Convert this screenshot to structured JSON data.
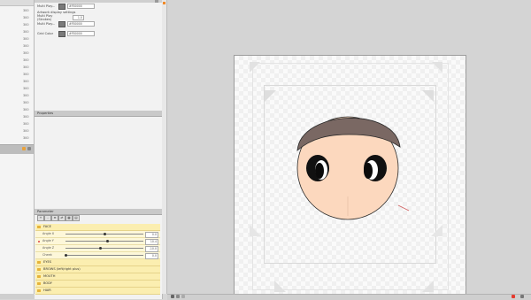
{
  "left_list": {
    "numbers": [
      "300",
      "300",
      "300",
      "300",
      "300",
      "300",
      "300",
      "300",
      "300",
      "300",
      "300",
      "300",
      "300",
      "300",
      "300",
      "300",
      "300",
      "300",
      "300"
    ]
  },
  "inspector": {
    "rows": [
      {
        "label": "Multi Play...",
        "value": "#FB0000"
      },
      {
        "label": "Artwork display settings",
        "value": ""
      },
      {
        "label": "Multi Play (Strokes)",
        "value": "1.0"
      },
      {
        "label": "Multi Play...",
        "value": "#FB0000"
      },
      {
        "label": "Grid Color",
        "value": "#FB0000"
      }
    ]
  },
  "mid_panel": {
    "title": "Properties"
  },
  "param_panel": {
    "title": "Parameter",
    "toolbar_buttons": [
      "+",
      "-",
      "≡",
      "⇄",
      "▦",
      "▤"
    ],
    "groups": [
      {
        "label": "FACE",
        "params": [
          {
            "name": "Angle X",
            "value": "0.0",
            "knob": 0.5
          },
          {
            "name": "Angle Y",
            "value": "10.4",
            "knob": 0.54,
            "active": true
          },
          {
            "name": "Angle Z",
            "value": "-10.0",
            "knob": 0.45
          },
          {
            "name": "Cheek",
            "value": "0.0",
            "knob": 0.0
          }
        ]
      },
      {
        "label": "EYES"
      },
      {
        "label": "BROWS (left/right plus)"
      },
      {
        "label": "MOUTH"
      },
      {
        "label": "BODY"
      },
      {
        "label": "HAIR"
      }
    ]
  },
  "colors": {
    "accent": "#f08a2a",
    "hair": "#7a6863",
    "skin": "#fcd8be",
    "group_bg": "#fbeeb0"
  }
}
